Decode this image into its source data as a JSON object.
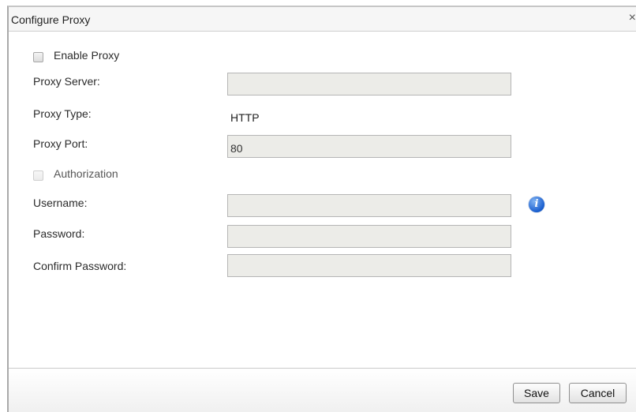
{
  "dialog": {
    "title": "Configure Proxy",
    "close_glyph": "×"
  },
  "form": {
    "enable_proxy_label": "Enable Proxy",
    "enable_proxy_checked": false,
    "proxy_server_label": "Proxy Server:",
    "proxy_server_value": "",
    "proxy_type_label": "Proxy Type:",
    "proxy_type_value": "HTTP",
    "proxy_port_label": "Proxy Port:",
    "proxy_port_value": "80",
    "authorization_label": "Authorization",
    "authorization_checked": false,
    "username_label": "Username:",
    "username_value": "",
    "password_label": "Password:",
    "password_value": "",
    "confirm_password_label": "Confirm Password:",
    "confirm_password_value": "",
    "info_icon_glyph": "i"
  },
  "footer": {
    "save_label": "Save",
    "cancel_label": "Cancel"
  }
}
